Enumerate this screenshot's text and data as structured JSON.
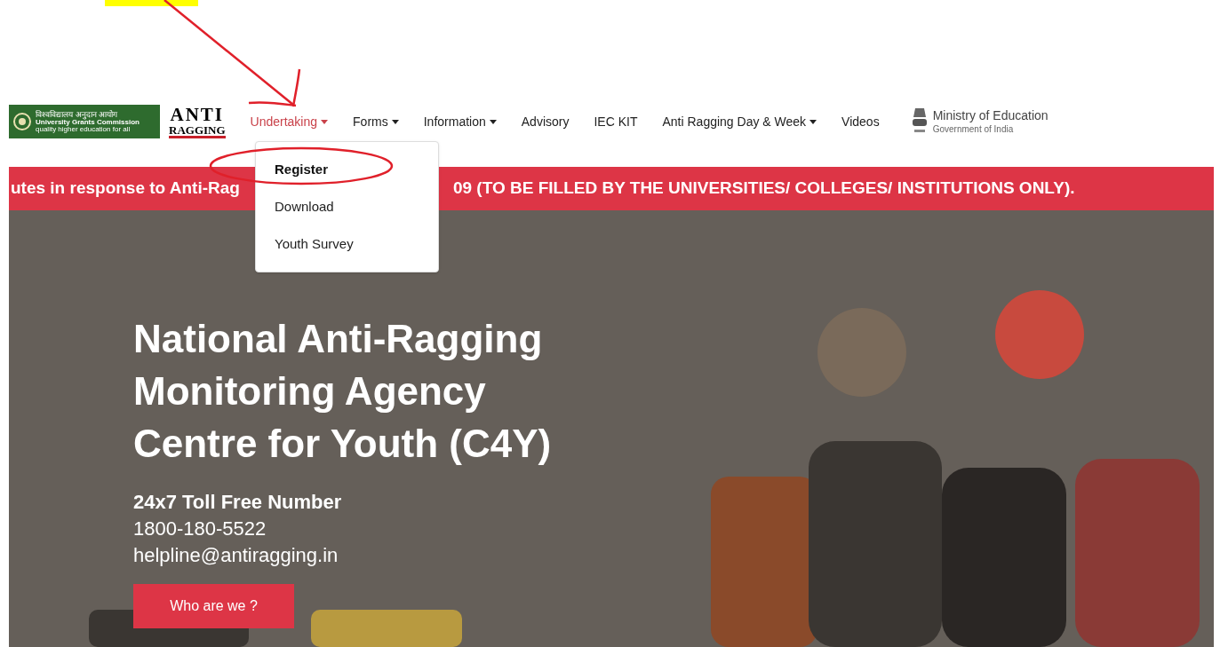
{
  "logos": {
    "ugc": {
      "hindi": "विश्वविद्यालय अनुदान आयोग",
      "name": "University Grants Commission",
      "tagline": "quality higher education for all"
    },
    "anti_ragging": {
      "line_1": "ANTI",
      "line_2": "RAGGING"
    },
    "ministry": {
      "name": "Ministry of Education",
      "sub": "Government of India"
    }
  },
  "nav": [
    {
      "label": "Undertaking",
      "dropdown": true,
      "selected": true
    },
    {
      "label": "Forms",
      "dropdown": true,
      "selected": false
    },
    {
      "label": "Information",
      "dropdown": true,
      "selected": false
    },
    {
      "label": "Advisory",
      "dropdown": false,
      "selected": false
    },
    {
      "label": "IEC KIT",
      "dropdown": false,
      "selected": false
    },
    {
      "label": "Anti Ragging Day & Week",
      "dropdown": true,
      "selected": false
    },
    {
      "label": "Videos",
      "dropdown": false,
      "selected": false
    }
  ],
  "dropdown_menu": [
    {
      "label": "Register",
      "selected": true
    },
    {
      "label": "Download",
      "selected": false
    },
    {
      "label": "Youth Survey",
      "selected": false
    }
  ],
  "banner": {
    "left_text": "utes in response to Anti-Rag",
    "right_text": "09 (TO BE FILLED BY THE UNIVERSITIES/ COLLEGES/ INSTITUTIONS ONLY)."
  },
  "hero": {
    "title_lines": [
      "National Anti-Ragging",
      "Monitoring Agency",
      "Centre for Youth (C4Y)"
    ],
    "helpline_label": "24x7 Toll Free Number",
    "phone": "1800-180-5522",
    "email": "helpline@antiragging.in",
    "button": "Who are we ?"
  }
}
